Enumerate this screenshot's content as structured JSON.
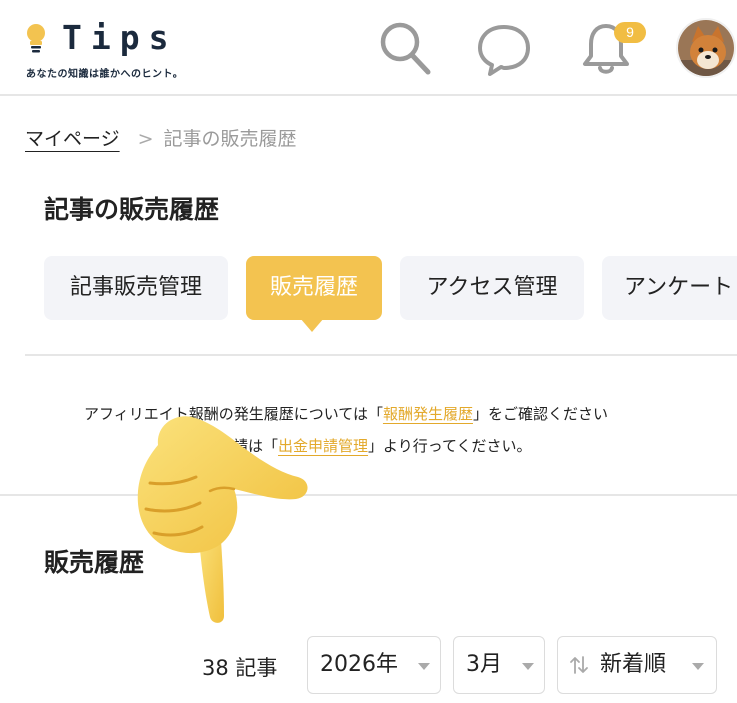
{
  "header": {
    "logo_text": "Tips",
    "tagline": "あなたの知識は誰かへのヒント。",
    "notification_count": "9",
    "icons": [
      "lightbulb-icon",
      "search-icon",
      "chat-icon",
      "bell-icon"
    ],
    "accent_color": "#f3c350",
    "navy_color": "#1b2a3d"
  },
  "breadcrumb": {
    "home": "マイページ",
    "separator": ">",
    "current": "記事の販売履歴"
  },
  "page": {
    "title": "記事の販売履歴",
    "tabs": [
      {
        "label": "記事販売管理",
        "active": false
      },
      {
        "label": "販売履歴",
        "active": true
      },
      {
        "label": "アクセス管理",
        "active": false
      },
      {
        "label": "アンケート",
        "active": false
      }
    ]
  },
  "notice": {
    "line1_prefix": "アフィリエイト報酬の発生履歴については「",
    "line1_link": "報酬発生履歴",
    "line1_suffix": "」をご確認ください",
    "line2_prefix": "申請は「",
    "line2_link": "出金申請管理",
    "line2_suffix": "」より行ってください。",
    "link_color": "#e3a92b"
  },
  "sales": {
    "title": "販売履歴",
    "count": "38 記事",
    "year": "2026年",
    "month": "3月",
    "sort": "新着順",
    "sort_icon": "sort-arrows-icon"
  },
  "overlay": {
    "icon": "pointing-hand-icon"
  }
}
